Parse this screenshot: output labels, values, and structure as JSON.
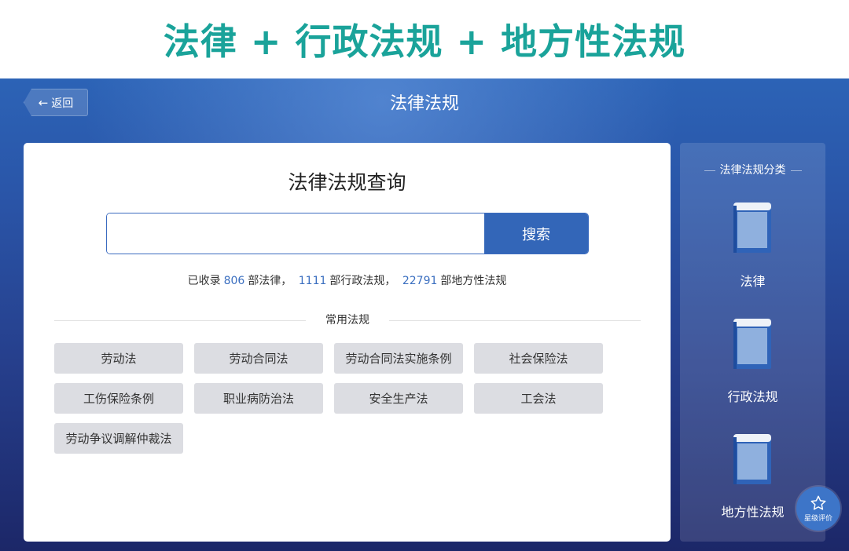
{
  "banner": {
    "title": "法律 + 行政法规 + 地方性法规"
  },
  "header": {
    "back_label": "返回",
    "title": "法律法规"
  },
  "query": {
    "title": "法律法规查询",
    "search_placeholder": "",
    "search_button": "搜索",
    "stats": {
      "prefix": "已收录",
      "law_count": "806",
      "law_suffix": "部法律，",
      "admin_count": "1111",
      "admin_suffix": "部行政法规，",
      "local_count": "22791",
      "local_suffix": "部地方性法规"
    },
    "common_label": "常用法规",
    "common_laws": [
      "劳动法",
      "劳动合同法",
      "劳动合同法实施条例",
      "社会保险法",
      "工伤保险条例",
      "职业病防治法",
      "安全生产法",
      "工会法",
      "劳动争议调解仲裁法"
    ]
  },
  "sidebar": {
    "title": "法律法规分类",
    "items": [
      {
        "label": "法律",
        "icon": "book-icon"
      },
      {
        "label": "行政法规",
        "icon": "book-icon"
      },
      {
        "label": "地方性法规",
        "icon": "book-icon"
      }
    ]
  },
  "rating": {
    "label": "星级评价",
    "icon": "star-icon"
  },
  "colors": {
    "banner_teal": "#1aa39a",
    "accent_blue": "#3366b8",
    "tag_gray": "#dcdde2"
  }
}
